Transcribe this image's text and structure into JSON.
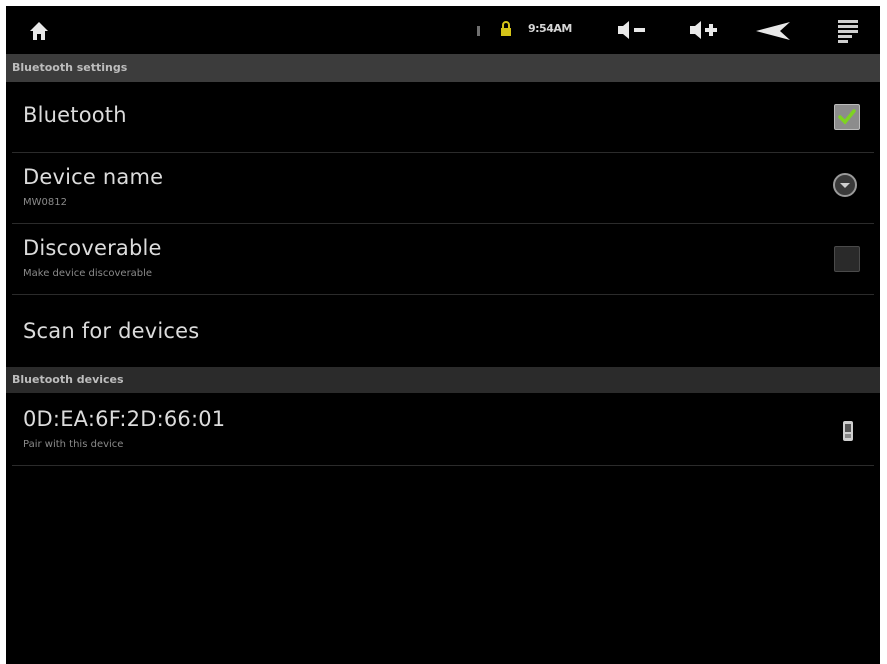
{
  "status_bar": {
    "time": "9:54AM",
    "icons": [
      "home-icon",
      "signal-icon",
      "lock-icon",
      "volume-down-icon",
      "volume-up-icon",
      "back-icon",
      "menu-icon"
    ]
  },
  "sections": {
    "bluetooth_settings": "Bluetooth settings",
    "bluetooth_devices": "Bluetooth devices"
  },
  "settings": {
    "bluetooth": {
      "title": "Bluetooth",
      "checked": true
    },
    "device_name": {
      "title": "Device name",
      "value": "MW0812"
    },
    "discoverable": {
      "title": "Discoverable",
      "summary": "Make device discoverable",
      "checked": false
    },
    "scan": {
      "title": "Scan for devices"
    }
  },
  "devices": [
    {
      "address": "0D:EA:6F:2D:66:01",
      "summary": "Pair with this device",
      "icon": "phone-icon"
    }
  ],
  "colors": {
    "background": "#000000",
    "section_header": "#3c3c3c",
    "check_accent": "#7ed321"
  }
}
